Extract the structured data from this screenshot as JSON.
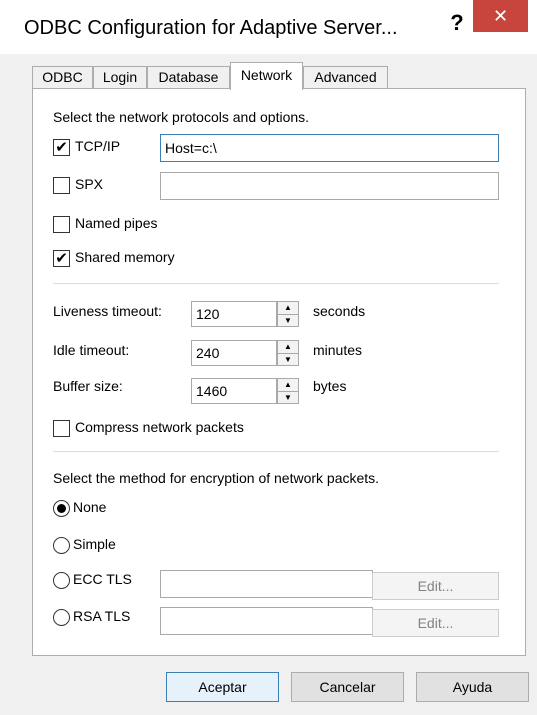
{
  "window": {
    "title": "ODBC Configuration for Adaptive Server...",
    "help_glyph": "?",
    "close_glyph": "✕"
  },
  "tabs": [
    {
      "label": "ODBC"
    },
    {
      "label": "Login"
    },
    {
      "label": "Database"
    },
    {
      "label": "Network",
      "active": true
    },
    {
      "label": "Advanced"
    }
  ],
  "network": {
    "protocols_heading": "Select the network protocols and options.",
    "tcpip": {
      "label": "TCP/IP",
      "checked": true,
      "value": "Host=c:\\"
    },
    "spx": {
      "label": "SPX",
      "checked": false,
      "value": ""
    },
    "named_pipes": {
      "label": "Named pipes",
      "checked": false
    },
    "shared_memory": {
      "label": "Shared memory",
      "checked": true
    },
    "liveness_timeout": {
      "label": "Liveness timeout:",
      "value": "120",
      "unit": "seconds"
    },
    "idle_timeout": {
      "label": "Idle timeout:",
      "value": "240",
      "unit": "minutes"
    },
    "buffer_size": {
      "label": "Buffer size:",
      "value": "1460",
      "unit": "bytes"
    },
    "compress": {
      "label": "Compress network packets",
      "checked": false
    },
    "encryption_heading": "Select the method for encryption of network packets.",
    "encryption": {
      "none": {
        "label": "None",
        "selected": true
      },
      "simple": {
        "label": "Simple",
        "selected": false
      },
      "ecc_tls": {
        "label": "ECC TLS",
        "selected": false,
        "value": "",
        "edit_label": "Edit..."
      },
      "rsa_tls": {
        "label": "RSA TLS",
        "selected": false,
        "value": "",
        "edit_label": "Edit..."
      }
    }
  },
  "buttons": {
    "accept": "Aceptar",
    "cancel": "Cancelar",
    "help": "Ayuda"
  },
  "glyphs": {
    "check": "✔",
    "spin_up": "▲",
    "spin_down": "▼"
  },
  "colors": {
    "close_button": "#c7453c",
    "focus_border": "#3c7fb1"
  }
}
